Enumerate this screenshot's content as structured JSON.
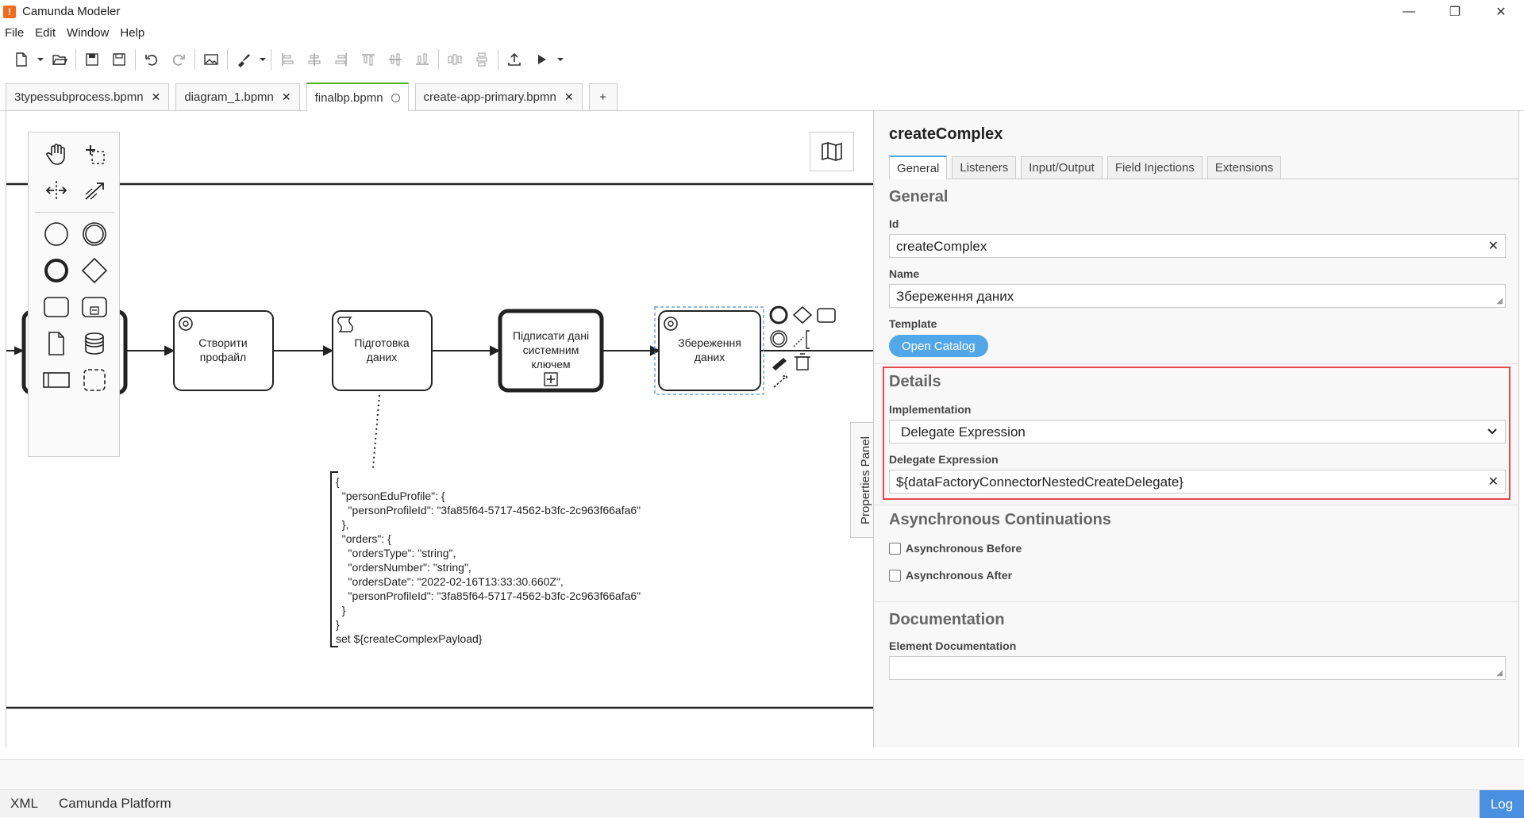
{
  "window": {
    "title": "Camunda Modeler",
    "minimize": "—",
    "restore": "❐",
    "close": "✕"
  },
  "menu": {
    "file": "File",
    "edit": "Edit",
    "window": "Window",
    "help": "Help"
  },
  "tabs": [
    {
      "label": "3typessubprocess.bpmn",
      "close": "✕"
    },
    {
      "label": "diagram_1.bpmn",
      "close": "✕"
    },
    {
      "label": "finalbp.bpmn"
    },
    {
      "label": "create-app-primary.bpmn",
      "close": "✕"
    },
    {
      "label": "+"
    }
  ],
  "diagram": {
    "tasks": [
      {
        "line1": "Створити",
        "line2": "профайл"
      },
      {
        "line1": "Підготовка",
        "line2": "даних"
      },
      {
        "line1": "Підписати дані",
        "line2": "системним",
        "line3": "ключем"
      },
      {
        "line1": "Збереження",
        "line2": "даних"
      }
    ],
    "annotation": "{\n  \"personEduProfile\": {\n    \"personProfileId\": \"3fa85f64-5717-4562-b3fc-2c963f66afa6\"\n  },\n  \"orders\": {\n    \"ordersType\": \"string\",\n    \"ordersNumber\": \"string\",\n    \"ordersDate\": \"2022-02-16T13:33:30.660Z\",\n    \"personProfileId\": \"3fa85f64-5717-4562-b3fc-2c963f66afa6\"\n  }\n}\nset ${createComplexPayload}"
  },
  "properties_toggle": "Properties Panel",
  "panel": {
    "title": "createComplex",
    "tabs": [
      "General",
      "Listeners",
      "Input/Output",
      "Field Injections",
      "Extensions"
    ],
    "general": {
      "heading": "General",
      "id_label": "Id",
      "id_value": "createComplex",
      "name_label": "Name",
      "name_value": "Збереження даних",
      "template_label": "Template",
      "template_button": "Open Catalog",
      "clear": "✕"
    },
    "details": {
      "heading": "Details",
      "impl_label": "Implementation",
      "impl_value": "Delegate Expression",
      "expr_label": "Delegate Expression",
      "expr_value": "${dataFactoryConnectorNestedCreateDelegate}"
    },
    "async": {
      "heading": "Asynchronous Continuations",
      "before": "Asynchronous Before",
      "after": "Asynchronous After"
    },
    "docs": {
      "heading": "Documentation",
      "label": "Element Documentation"
    }
  },
  "statusbar": {
    "xml": "XML",
    "platform": "Camunda Platform",
    "log": "Log"
  }
}
